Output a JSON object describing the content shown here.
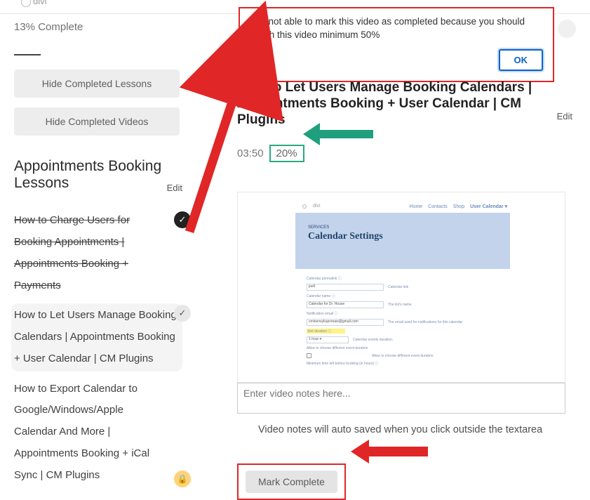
{
  "logo": {
    "text": "divi"
  },
  "progress": {
    "label": "13% Complete"
  },
  "sidebar": {
    "hide_lessons_label": "Hide Completed Lessons",
    "hide_videos_label": "Hide Completed Videos",
    "heading": "Appointments Booking Lessons",
    "edit_label": "Edit",
    "items": [
      {
        "label": "How to Charge Users for Booking Appointments | Appointments Booking + Payments",
        "strike": true,
        "badge": "dark"
      },
      {
        "label": "How to Let Users Manage Booking Calendars | Appointments Booking + User Calendar | CM Plugins",
        "strike": false,
        "badge": "light",
        "active": true
      },
      {
        "label": "How to Export Calendar to Google/Windows/Apple Calendar And More | Appointments Booking + iCal Sync | CM Plugins",
        "strike": false,
        "badge": "lock"
      }
    ]
  },
  "alert": {
    "text": "You not able to mark this video as completed because you should watch this video minimum 50%",
    "ok_label": "OK"
  },
  "main": {
    "title": "How to Let Users Manage Booking Calendars | Appointments Booking + User Calendar | CM Plugins",
    "edit_label": "Edit",
    "time": "03:50",
    "percent": "20%"
  },
  "video": {
    "logo": "divi",
    "nav": [
      "Home",
      "Contacts",
      "Shop",
      "User Calendar ▾"
    ],
    "hero_sub": "SERVICES",
    "hero_title": "Calendar Settings",
    "rows": {
      "permalink_label": "Calendar permalink ⓘ",
      "permalink_value": "joe6",
      "permalink_hint": "Calendar link",
      "name_label": "Calendar name ⓘ",
      "name_value": "Calendar for Dr. House",
      "name_hint": "The list's name.",
      "email_label": "Notification email ⓘ",
      "email_value": "cminensykuprenaw@gmail.com",
      "email_hint": "The email used for notifications for this calendar",
      "duration_label": "Slot duration ⓘ",
      "duration_value": "1 hour ▾",
      "duration_hint": "Calendar events duration.",
      "diff_label": "Allow to choose different event duration",
      "diff_hint": "Allow to choose different event duration.",
      "hours_label": "Minimum time left before booking (in hours) ⓘ"
    }
  },
  "notes": {
    "placeholder": "Enter video notes here...",
    "caption": "Video notes will auto saved when you click outside the textarea"
  },
  "mark_complete": {
    "label": "Mark Complete"
  }
}
